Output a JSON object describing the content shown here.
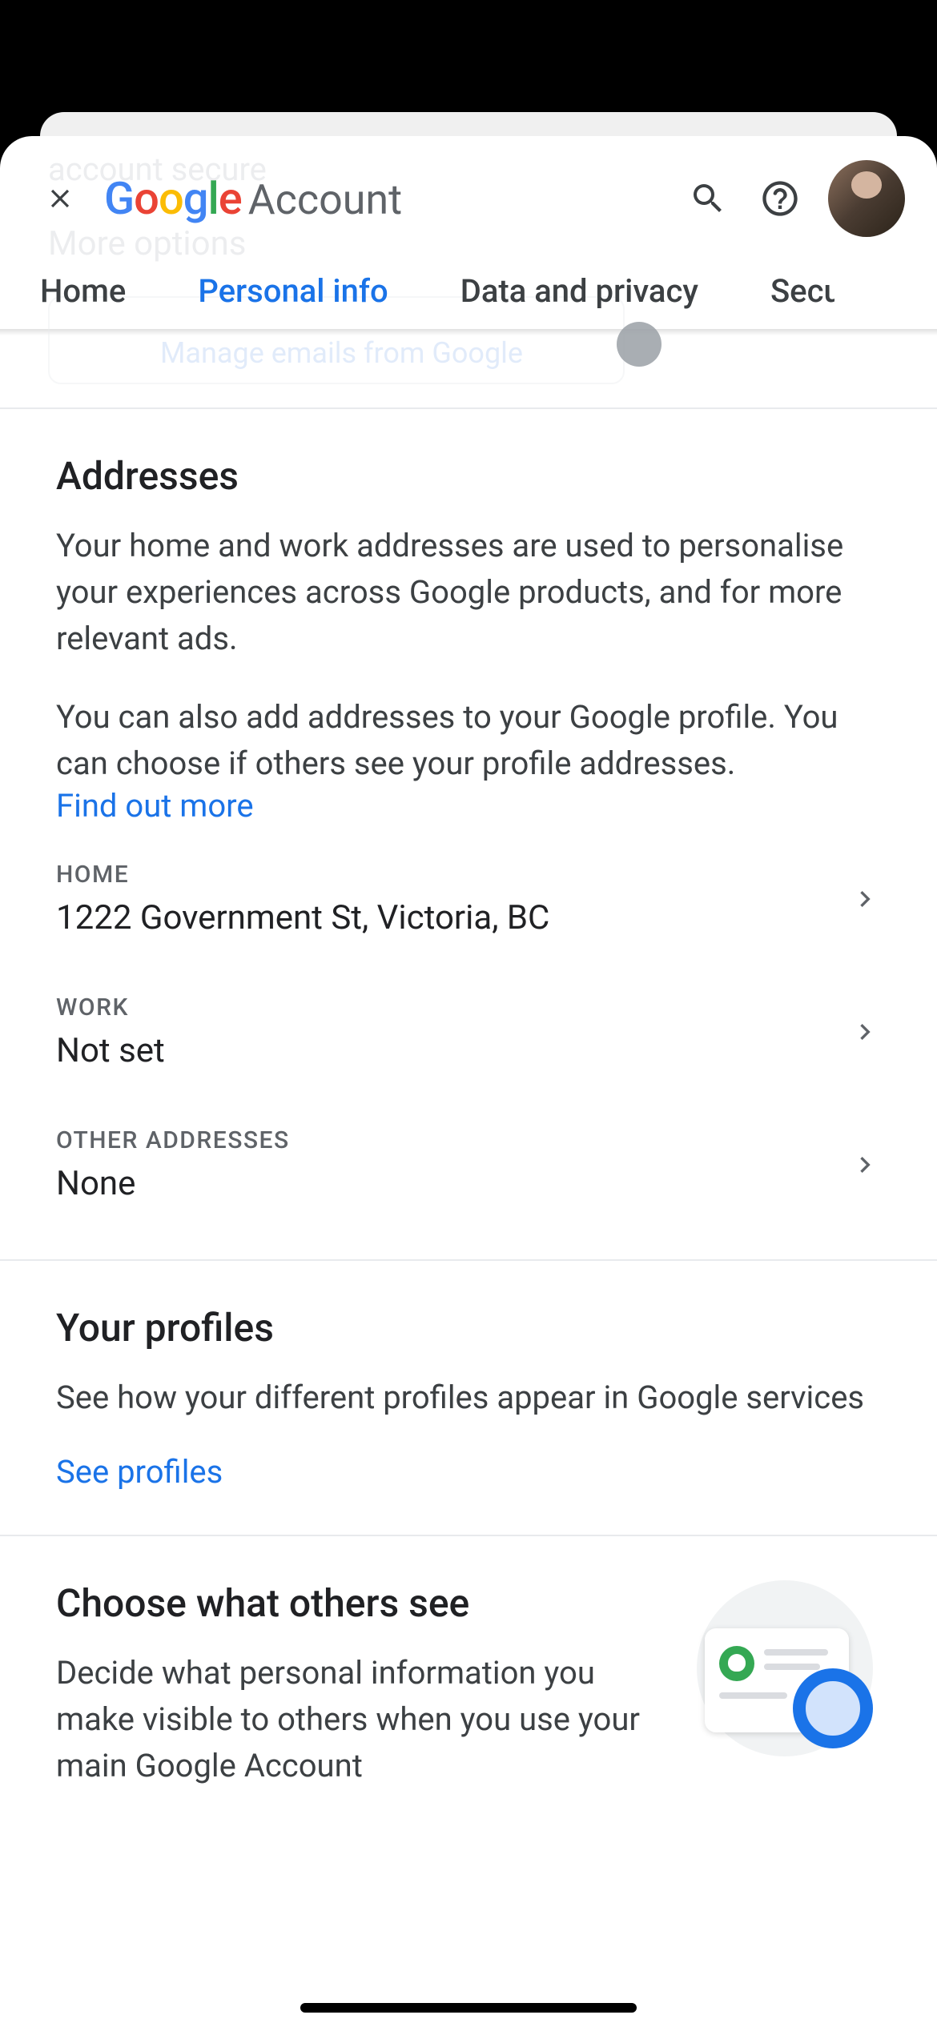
{
  "ghost": {
    "line1": "account secure",
    "line2": "More options",
    "line3": "Manage emails from Google"
  },
  "header": {
    "brand": "Google",
    "product": "Account"
  },
  "tabs": {
    "home": "Home",
    "personal_info": "Personal info",
    "data_privacy": "Data and privacy",
    "security": "Security"
  },
  "addresses": {
    "title": "Addresses",
    "desc1": "Your home and work addresses are used to personalise your experiences across Google products, and for more relevant ads.",
    "desc2": "You can also add addresses to your Google profile. You can choose if others see your profile addresses.",
    "find_out_more": "Find out more",
    "home_label": "HOME",
    "home_value": "1222 Government St, Victoria, BC",
    "work_label": "WORK",
    "work_value": "Not set",
    "other_label": "OTHER ADDRESSES",
    "other_value": "None"
  },
  "profiles": {
    "title": "Your profiles",
    "desc": "See how your different profiles appear in Google services",
    "link": "See profiles"
  },
  "others": {
    "title": "Choose what others see",
    "desc": "Decide what personal information you make visible to others when you use your main Google Account"
  }
}
